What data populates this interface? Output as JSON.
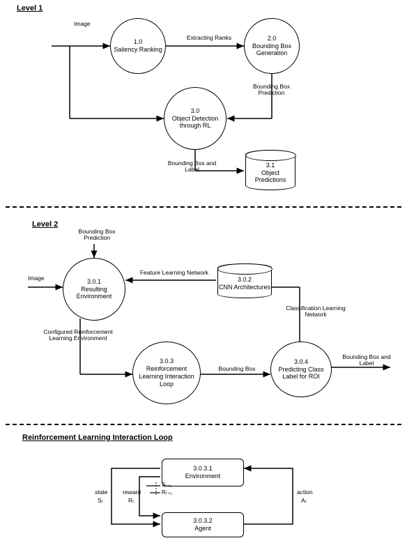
{
  "level1": {
    "title": "Level 1",
    "image_label": "Image",
    "node1": {
      "id": "1.0",
      "name": "Saliency Ranking"
    },
    "node2": {
      "id": "2.0",
      "name": "Bounding Box Generation"
    },
    "node3": {
      "id": "3.0",
      "name": "Object Detection through RL"
    },
    "store31": {
      "id": "3.1",
      "name": "Object Predictions"
    },
    "edge_extract": "Extracting Ranks",
    "edge_bbpred": "Bounding Box Prediction",
    "edge_bblabel": "Bounding Box and Label"
  },
  "level2": {
    "title": "Level 2",
    "image_label": "Image",
    "bbpred_label": "Bounding Box Prediction",
    "node301": {
      "id": "3.0.1",
      "name": "Resulting Environment"
    },
    "store302": {
      "id": "3.0.2",
      "name": "CNN Architectures"
    },
    "node303": {
      "id": "3.0.3",
      "name": "Reinforcement Learning Interaction Loop"
    },
    "node304": {
      "id": "3.0.4",
      "name": "Predicting Class Label for ROI"
    },
    "edge_feat": "Feature Learning Network",
    "edge_config": "Configured Reinforcement Learning Environment",
    "edge_class": "Classification Learning Network",
    "edge_bb": "Bounding Box",
    "edge_out": "Bounding Box and Label"
  },
  "rlloop": {
    "title": "Reinforcement Learning Interaction Loop",
    "env": {
      "id": "3.0.3.1",
      "name": "Environment"
    },
    "agent": {
      "id": "3.0.3.2",
      "name": "Agent"
    },
    "state_sub": "state",
    "state_var": "Sₜ",
    "reward_sub": "reward",
    "reward_var": "Rₜ",
    "next_state": "Sₜ₊₁",
    "next_reward": "Rₜ₊₁",
    "action_sub": "action",
    "action_var": "Aₜ"
  }
}
